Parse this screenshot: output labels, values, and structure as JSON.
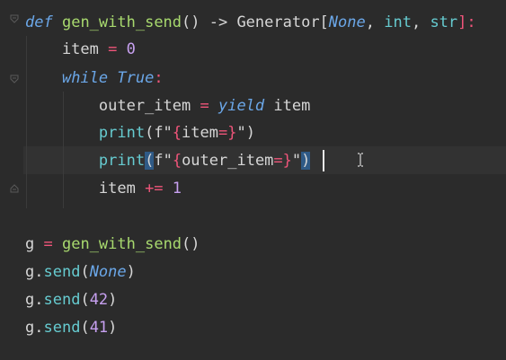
{
  "code": {
    "lines": [
      {
        "tokens": [
          {
            "text": "def",
            "kind": "kw"
          },
          {
            "text": " ",
            "kind": "plain"
          },
          {
            "text": "gen_with_send",
            "kind": "fn"
          },
          {
            "text": "() -> Generator[",
            "kind": "plain"
          },
          {
            "text": "None",
            "kind": "kwc"
          },
          {
            "text": ", ",
            "kind": "plain"
          },
          {
            "text": "int",
            "kind": "builtin"
          },
          {
            "text": ", ",
            "kind": "plain"
          },
          {
            "text": "str",
            "kind": "builtin"
          },
          {
            "text": "]:",
            "kind": "op"
          }
        ]
      },
      {
        "tokens": [
          {
            "text": "    item ",
            "kind": "plain"
          },
          {
            "text": "=",
            "kind": "op"
          },
          {
            "text": " ",
            "kind": "plain"
          },
          {
            "text": "0",
            "kind": "num"
          }
        ]
      },
      {
        "tokens": [
          {
            "text": "    ",
            "kind": "plain"
          },
          {
            "text": "while",
            "kind": "kw"
          },
          {
            "text": " ",
            "kind": "plain"
          },
          {
            "text": "True",
            "kind": "kwc"
          },
          {
            "text": ":",
            "kind": "op"
          }
        ]
      },
      {
        "tokens": [
          {
            "text": "        outer_item ",
            "kind": "plain"
          },
          {
            "text": "=",
            "kind": "op"
          },
          {
            "text": " ",
            "kind": "plain"
          },
          {
            "text": "yield",
            "kind": "kw"
          },
          {
            "text": " item",
            "kind": "plain"
          }
        ]
      },
      {
        "tokens": [
          {
            "text": "        ",
            "kind": "plain"
          },
          {
            "text": "print",
            "kind": "builtin"
          },
          {
            "text": "(f\"",
            "kind": "plain"
          },
          {
            "text": "{",
            "kind": "brace"
          },
          {
            "text": "item",
            "kind": "plain"
          },
          {
            "text": "=}",
            "kind": "brace"
          },
          {
            "text": "\")",
            "kind": "plain"
          }
        ]
      },
      {
        "tokens": [
          {
            "text": "        ",
            "kind": "plain"
          },
          {
            "text": "print",
            "kind": "builtin"
          },
          {
            "text": "(",
            "kind": "plain",
            "highlight": true
          },
          {
            "text": "f\"",
            "kind": "plain"
          },
          {
            "text": "{",
            "kind": "brace"
          },
          {
            "text": "outer_item",
            "kind": "plain"
          },
          {
            "text": "=}",
            "kind": "brace"
          },
          {
            "text": "\"",
            "kind": "plain"
          },
          {
            "text": ")",
            "kind": "plain",
            "highlight": true
          }
        ]
      },
      {
        "tokens": [
          {
            "text": "        item ",
            "kind": "plain"
          },
          {
            "text": "+=",
            "kind": "op"
          },
          {
            "text": " ",
            "kind": "plain"
          },
          {
            "text": "1",
            "kind": "num"
          }
        ]
      },
      {
        "tokens": []
      },
      {
        "tokens": [
          {
            "text": "g ",
            "kind": "plain"
          },
          {
            "text": "=",
            "kind": "op"
          },
          {
            "text": " ",
            "kind": "plain"
          },
          {
            "text": "gen_with_send",
            "kind": "fn"
          },
          {
            "text": "()",
            "kind": "plain"
          }
        ]
      },
      {
        "tokens": [
          {
            "text": "g.",
            "kind": "plain"
          },
          {
            "text": "send",
            "kind": "builtin"
          },
          {
            "text": "(",
            "kind": "plain"
          },
          {
            "text": "None",
            "kind": "kwc"
          },
          {
            "text": ")",
            "kind": "plain"
          }
        ]
      },
      {
        "tokens": [
          {
            "text": "g.",
            "kind": "plain"
          },
          {
            "text": "send",
            "kind": "builtin"
          },
          {
            "text": "(",
            "kind": "plain"
          },
          {
            "text": "42",
            "kind": "num"
          },
          {
            "text": ")",
            "kind": "plain"
          }
        ]
      },
      {
        "tokens": [
          {
            "text": "g.",
            "kind": "plain"
          },
          {
            "text": "send",
            "kind": "builtin"
          },
          {
            "text": "(",
            "kind": "plain"
          },
          {
            "text": "41",
            "kind": "num"
          },
          {
            "text": ")",
            "kind": "plain"
          }
        ]
      }
    ]
  },
  "colors": {
    "background": "#2b2b2b",
    "current_line": "#323232",
    "keyword": "#6ba7e8",
    "function": "#a8d96e",
    "number": "#c7a0f0",
    "operator": "#f0557a",
    "builtin": "#66cbd0",
    "bracket_match": "#2f5a86"
  },
  "icons": {
    "fold_open": "fold-open-icon",
    "fold_end": "fold-end-icon",
    "text_cursor": "ibeam-cursor-icon"
  }
}
